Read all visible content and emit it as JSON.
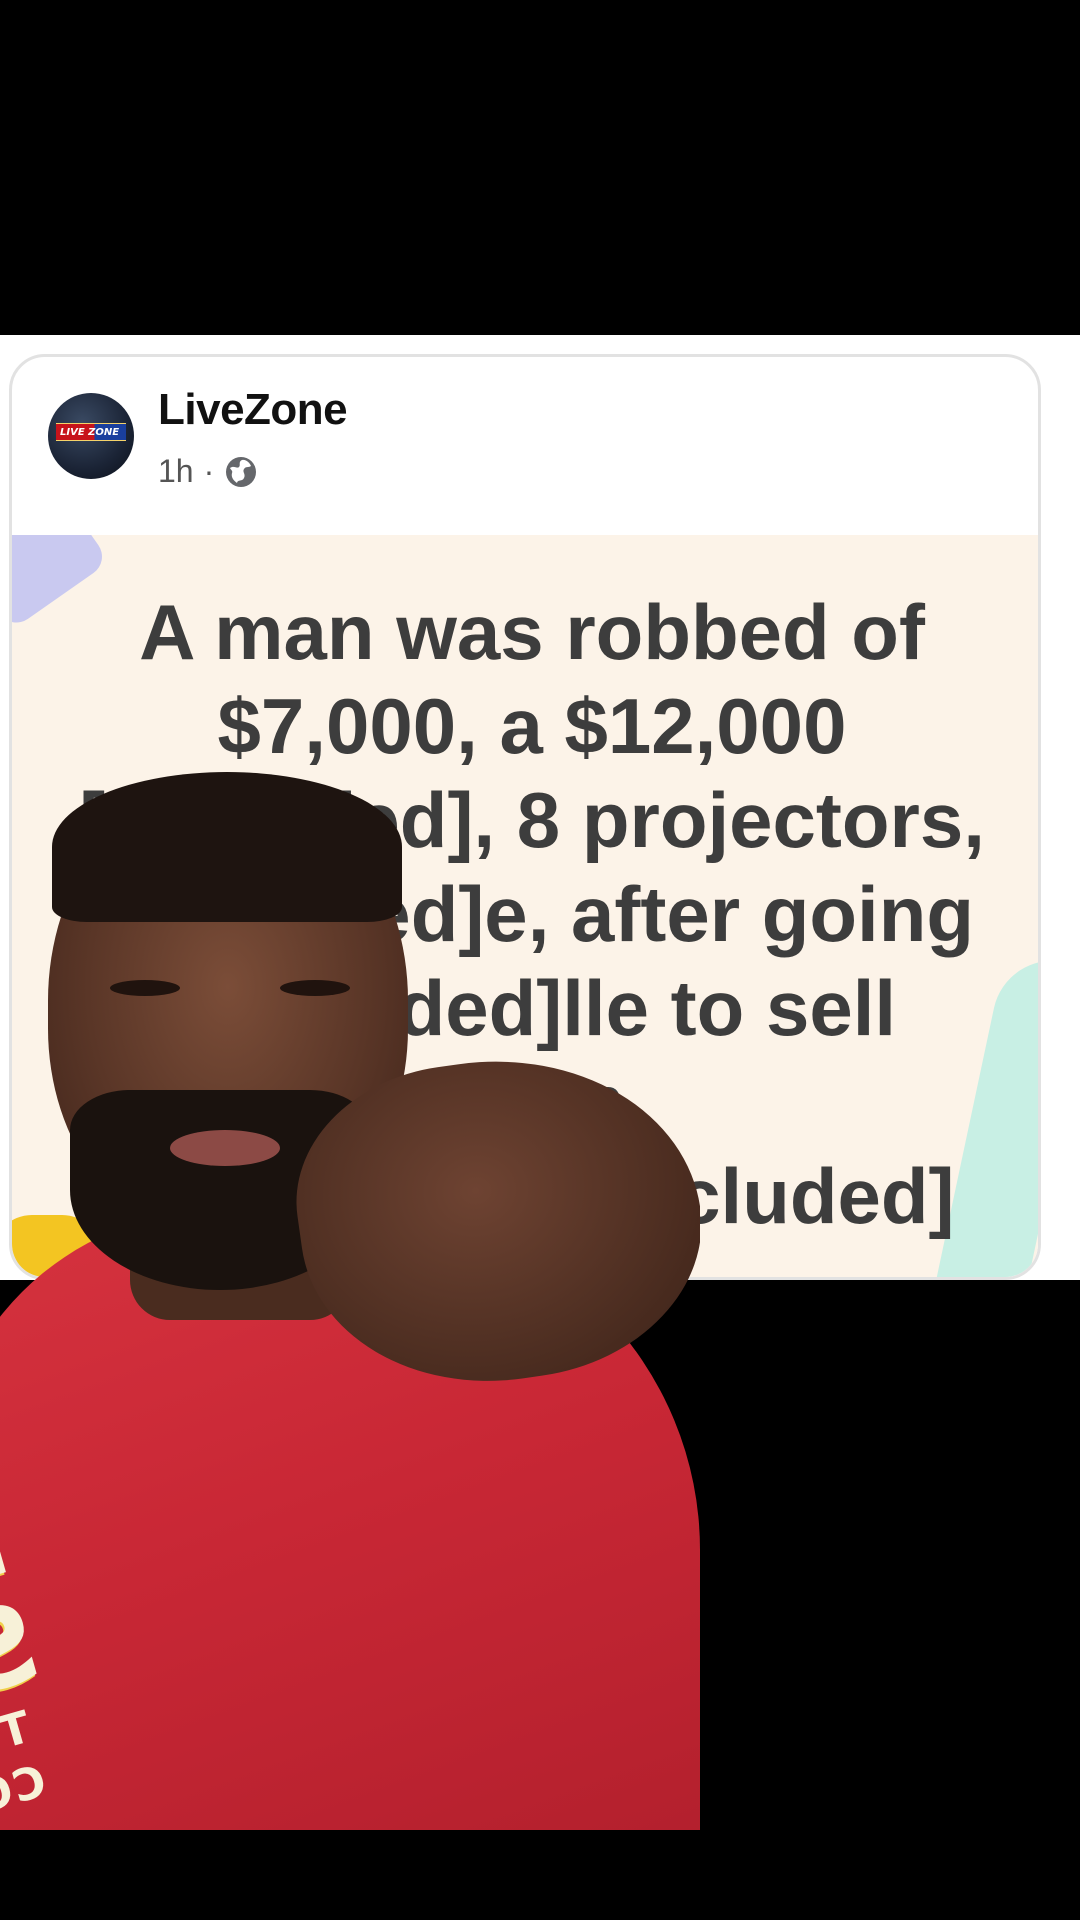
{
  "post": {
    "page_name": "LiveZone",
    "timestamp": "1h",
    "separator": "·",
    "privacy_icon": "globe-icon",
    "avatar_logo_text": "LIVE ZONE",
    "headline": "A man was robbed of $7,000, a $12,000 [occluded], 8 projectors, [occluded]e, after going [occluded]lle to sell them [occluded]tr[occluded] from"
  },
  "overlay": {
    "shirt_text_line1": "NOK STO",
    "shirt_text_line2": "THE GOOD IS COMING"
  },
  "colors": {
    "card_background": "#fcf3e8",
    "headline_text": "#3d3d3d",
    "shirt_red": "#c82735"
  }
}
